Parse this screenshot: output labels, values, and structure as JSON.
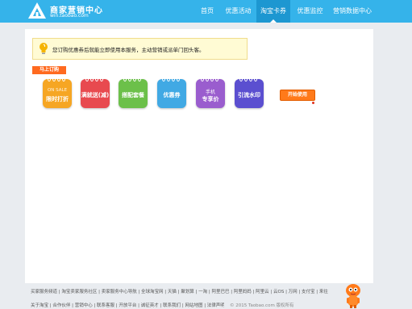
{
  "header": {
    "logo_title": "商家营销中心",
    "logo_sub": "win.taobao.com",
    "nav": [
      {
        "label": "首页"
      },
      {
        "label": "优惠活动"
      },
      {
        "label": "淘宝卡券"
      },
      {
        "label": "优惠监控"
      },
      {
        "label": "营销数据中心"
      }
    ],
    "active_nav": "淘宝卡券",
    "colors": {
      "bar": "#35b3ea",
      "active": "#1d97d1"
    }
  },
  "notice": {
    "icon": "lightbulb-icon",
    "text": "您订购优惠券后就能立即使用本服务，主动营销或派单门回头客。"
  },
  "section_tag": "马上订购",
  "tools": [
    {
      "sub": "ON SALE",
      "label": "限时打折",
      "color": "#f6a623"
    },
    {
      "sub": "",
      "label": "满就送(减)",
      "color": "#e84a4f"
    },
    {
      "sub": "",
      "label": "搭配套餐",
      "color": "#6cc04a"
    },
    {
      "sub": "",
      "label": "优惠券",
      "color": "#41a9e4"
    },
    {
      "sub": "手机",
      "label": "专享价",
      "color": "#9a5dce"
    },
    {
      "sub": "",
      "label": "引流水印",
      "color": "#5b4fd0"
    }
  ],
  "start_button": "开始使用",
  "footer": {
    "row1": "买家服务频道 | 淘宝卖家服务社区 | 卖家服务中心导航 | 全球淘宝网 | 天猫 | 聚划算 | 一淘 | 阿里巴巴 | 阿里妈妈 | 阿里云 | 云OS | 万网 | 支付宝 | 来往",
    "row2": "关于淘宝 | 合作伙伴 | 营销中心 | 联系客服 | 开放平台 | 诚征英才 | 联系我们 | 网站地图 | 法律声明",
    "copyright": "© 2015 Taobao.com 版权所有",
    "mascot": "taobao-mascot-icon"
  }
}
